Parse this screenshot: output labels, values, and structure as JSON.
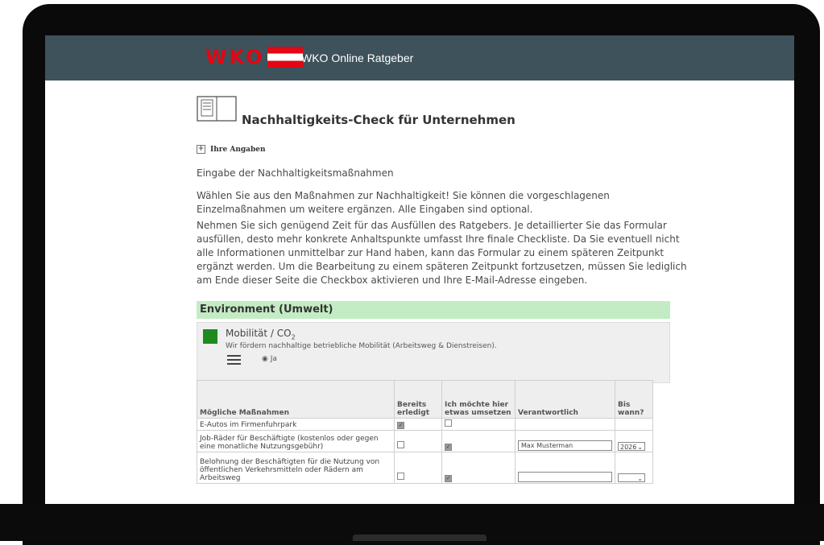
{
  "header": {
    "logo_letters": "WKO",
    "title": "WKO Online Ratgeber"
  },
  "page": {
    "title": "Nachhaltigkeits-Check für Unternehmen",
    "toggle_symbol": "+",
    "toggle_label": "Ihre Angaben",
    "subtitle": "Eingabe der Nachhaltigkeitsmaßnahmen",
    "para1": "Wählen Sie aus den Maßnahmen zur Nachhaltigkeit! Sie können die vorgeschlagenen Einzelmaßnahmen um weitere ergänzen. Alle Eingaben sind optional.",
    "para2": "Nehmen Sie sich genügend Zeit für das Ausfüllen des Ratgebers. Je detaillierter Sie das Formular ausfüllen, desto mehr konkrete Anhaltspunkte umfasst Ihre finale Checkliste. Da Sie eventuell nicht alle Informationen unmittelbar zur Hand haben, kann das Formular zu einem späteren Zeitpunkt ergänzt werden. Um die Bearbeitung zu einem späteren Zeitpunkt fortzusetzen, müssen Sie lediglich am Ende dieser Seite die Checkbox aktivieren und Ihre E-Mail-Adresse eingeben."
  },
  "section": {
    "title": "Environment (Umwelt)",
    "color": "#c4ecc4",
    "category": {
      "title": "Mobilität / CO",
      "title_sub": "2",
      "description": "Wir fördern nachhaltige betriebliche Mobilität (Arbeitsweg & Dienstreisen).",
      "radio_label": "Ja",
      "marker_color": "#1e8a1e"
    }
  },
  "table": {
    "headers": [
      "Mögliche Maßnahmen",
      "Bereits erledigt",
      "Ich möchte hier etwas umsetzen",
      "Verantwortlich",
      "Bis wann?"
    ],
    "rows": [
      {
        "label": "E-Autos im Firmenfuhrpark",
        "done": true,
        "want": false,
        "responsible": null,
        "when": null
      },
      {
        "label": "Job-Räder für Beschäftigte (kostenlos oder gegen eine monatliche Nutzungsgebühr)",
        "done": false,
        "want": true,
        "responsible": "Max Musterman",
        "when": "2026"
      },
      {
        "label": "Belohnung der Beschäftigten für die Nutzung von öffentlichen Verkehrsmitteln oder Rädern am Arbeitsweg",
        "done": false,
        "want": true,
        "responsible": "",
        "when": ""
      }
    ]
  },
  "icons": [
    "book-icon",
    "plus-toggle-icon",
    "hamburger-icon",
    "radio-icon",
    "checkbox-icon",
    "dropdown-arrow-icon"
  ]
}
